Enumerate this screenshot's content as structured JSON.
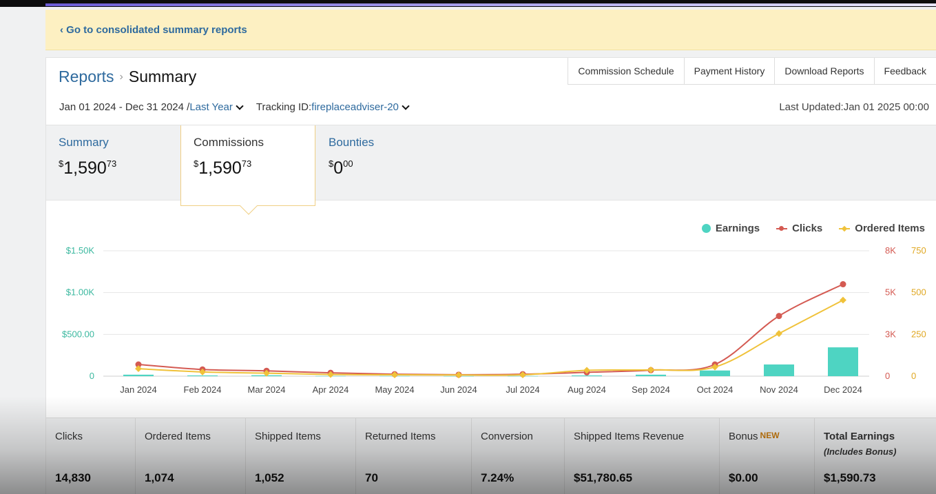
{
  "banner": {
    "link_label": "‹ Go to consolidated summary reports"
  },
  "breadcrumb": {
    "root": "Reports",
    "current": "Summary"
  },
  "top_nav": [
    "Commission Schedule",
    "Payment History",
    "Download Reports",
    "Feedback"
  ],
  "filters": {
    "date_range": "Jan 01 2024 - Dec 31 2024 /",
    "range_preset": "Last Year",
    "tracking_label": "Tracking ID:",
    "tracking_id": "fireplaceadviser-20",
    "last_updated": "Last Updated:Jan 01 2025 00:00"
  },
  "tabs": [
    {
      "label": "Summary",
      "currency": "$",
      "whole": "1,590",
      "cents": "73"
    },
    {
      "label": "Commissions",
      "currency": "$",
      "whole": "1,590",
      "cents": "73"
    },
    {
      "label": "Bounties",
      "currency": "$",
      "whole": "0",
      "cents": "00"
    }
  ],
  "legend": {
    "earnings": "Earnings",
    "clicks": "Clicks",
    "ordered": "Ordered Items"
  },
  "colors": {
    "earnings": "#4ed4c2",
    "clicks": "#d45a52",
    "ordered": "#f0c23a",
    "link": "#2e6a9e",
    "new_badge": "#c7790b"
  },
  "chart_data": {
    "type": "bar",
    "categories": [
      "Jan 2024",
      "Feb 2024",
      "Mar 2024",
      "Apr 2024",
      "May 2024",
      "Jun 2024",
      "Jul 2024",
      "Aug 2024",
      "Sep 2024",
      "Oct 2024",
      "Nov 2024",
      "Dec 2024"
    ],
    "series": [
      {
        "name": "Earnings",
        "type": "bar",
        "axis": "left",
        "values": [
          18,
          9,
          11,
          2,
          2,
          1,
          2,
          9,
          18,
          68,
          140,
          345
        ]
      },
      {
        "name": "Clicks",
        "type": "line",
        "axis": "right-clicks",
        "values": [
          700,
          400,
          320,
          200,
          120,
          90,
          120,
          230,
          360,
          700,
          3600,
          5500
        ]
      },
      {
        "name": "Ordered Items",
        "type": "line",
        "axis": "right-ordered",
        "values": [
          45,
          25,
          18,
          10,
          8,
          7,
          8,
          35,
          38,
          55,
          255,
          455
        ]
      }
    ],
    "left_axis": {
      "ticks": [
        "0",
        "$500.00",
        "$1.00K",
        "$1.50K"
      ],
      "range": [
        0,
        1500
      ]
    },
    "right_axis_clicks": {
      "ticks": [
        "0",
        "3K",
        "5K",
        "8K"
      ],
      "range": [
        0,
        7500
      ]
    },
    "right_axis_ordered": {
      "ticks": [
        "0",
        "250",
        "500",
        "750"
      ],
      "range": [
        0,
        750
      ]
    },
    "legend_position": "top-right",
    "grid": true
  },
  "stats": [
    {
      "label": "Clicks",
      "value": "14,830"
    },
    {
      "label": "Ordered Items",
      "value": "1,074"
    },
    {
      "label": "Shipped Items",
      "value": "1,052"
    },
    {
      "label": "Returned Items",
      "value": "70"
    },
    {
      "label": "Conversion",
      "value": "7.24%"
    },
    {
      "label": "Shipped Items Revenue",
      "value": "$51,780.65"
    },
    {
      "label": "Bonus",
      "badge": "NEW",
      "value": "$0.00"
    },
    {
      "label": "Total Earnings",
      "sub": "(Includes Bonus)",
      "value": "$1,590.73"
    }
  ]
}
